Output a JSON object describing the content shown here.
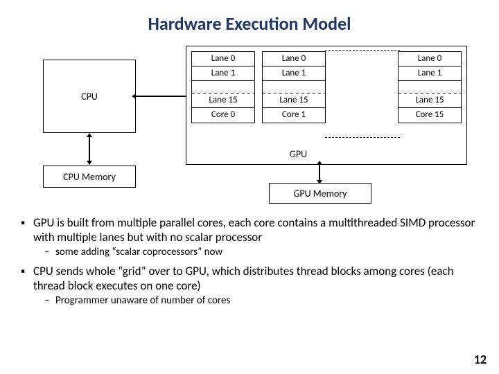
{
  "title": "Hardware Execution Model",
  "cpu_label": "CPU",
  "cpu_mem_label": "CPU Memory",
  "gpu_label": "GPU",
  "gpu_mem_label": "GPU Memory",
  "lanes": {
    "l0": "Lane 0",
    "l1": "Lane 1",
    "l15": "Lane 15"
  },
  "cores": {
    "c0": "Core 0",
    "c1": "Core 1",
    "c15": "Core 15"
  },
  "bullets": {
    "b1": "GPU is built from multiple parallel cores, each core contains a multithreaded SIMD processor with multiple lanes but with no scalar processor",
    "s1": "some adding “scalar coprocessors” now",
    "b2": "CPU sends whole “grid” over to GPU, which distributes thread blocks among cores (each thread block executes on one core)",
    "s2": "Programmer unaware of number of cores"
  },
  "marks": {
    "square": "▪",
    "dash": "–"
  },
  "page": "12"
}
